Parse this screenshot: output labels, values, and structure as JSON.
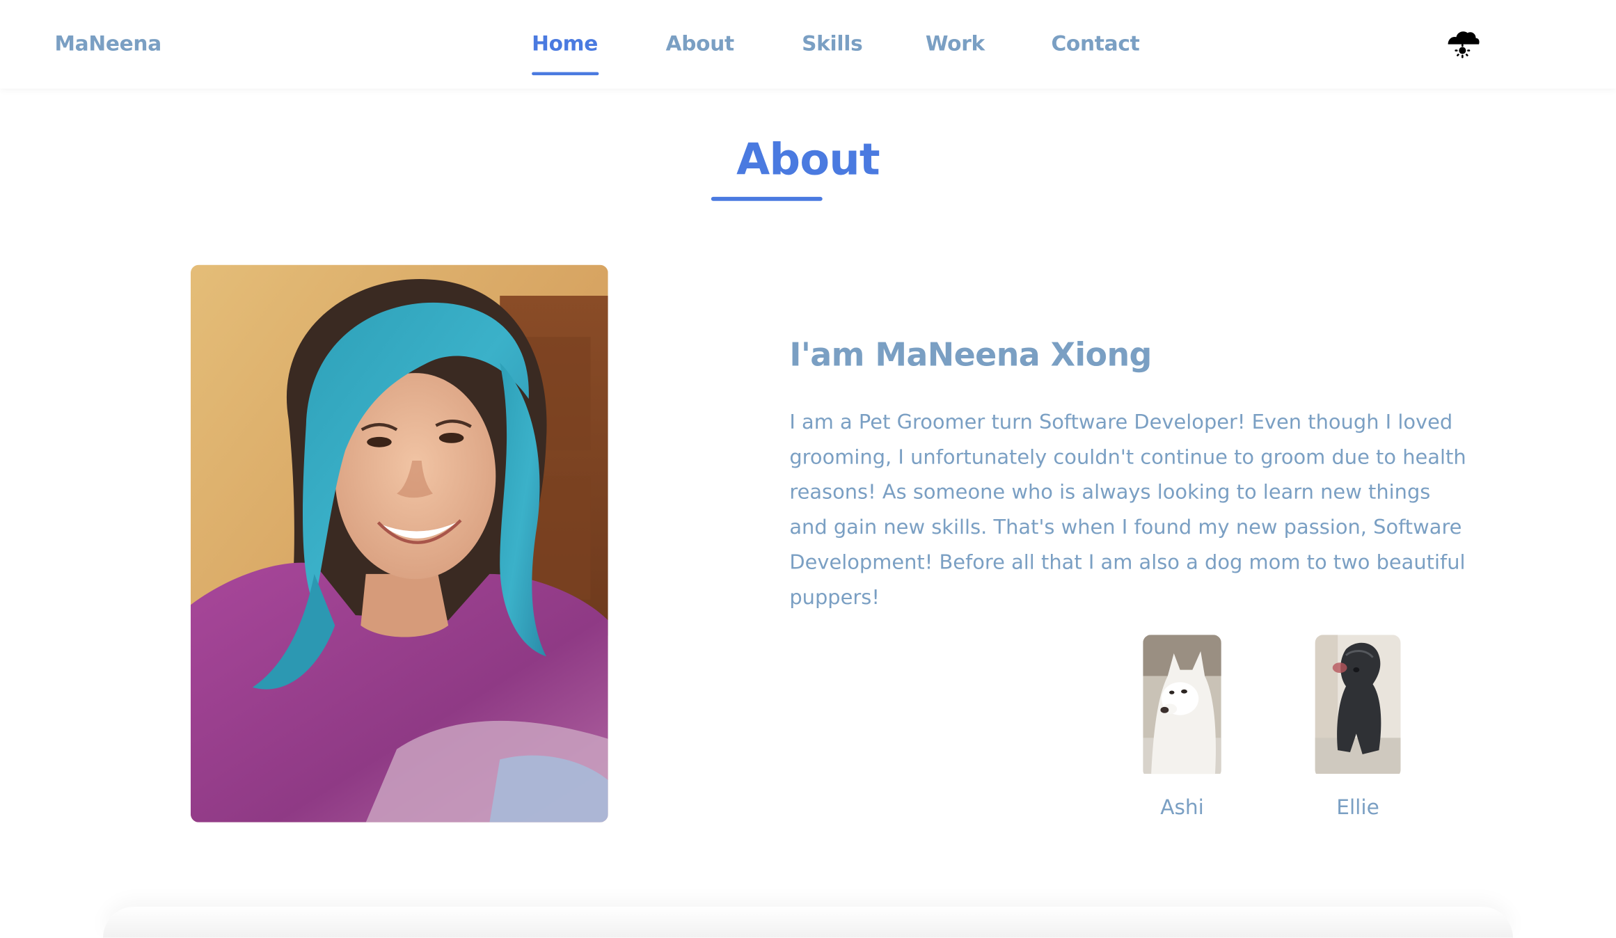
{
  "header": {
    "logo": "MaNeena",
    "nav": [
      {
        "label": "Home",
        "active": true
      },
      {
        "label": "About",
        "active": false
      },
      {
        "label": "Skills",
        "active": false
      },
      {
        "label": "Work",
        "active": false
      },
      {
        "label": "Contact",
        "active": false
      }
    ],
    "theme_toggle_icon": "weather-sun-cloud-icon"
  },
  "about": {
    "section_title": "About",
    "name_heading": "I'am MaNeena Xiong",
    "description": "I am a Pet Groomer turn Software Developer! Even though I loved grooming, I unfortunately couldn't continue to groom due to health reasons! As someone who is always looking to learn new things and gain new skills. That's when I found my new passion, Software Development! Before all that I am also a dog mom to two beautiful puppers!",
    "dogs": [
      {
        "name": "Ashi"
      },
      {
        "name": "Ellie"
      }
    ]
  },
  "colors": {
    "accent": "#4a7ae0",
    "text": "#7a9fc3",
    "background": "#ffffff"
  }
}
